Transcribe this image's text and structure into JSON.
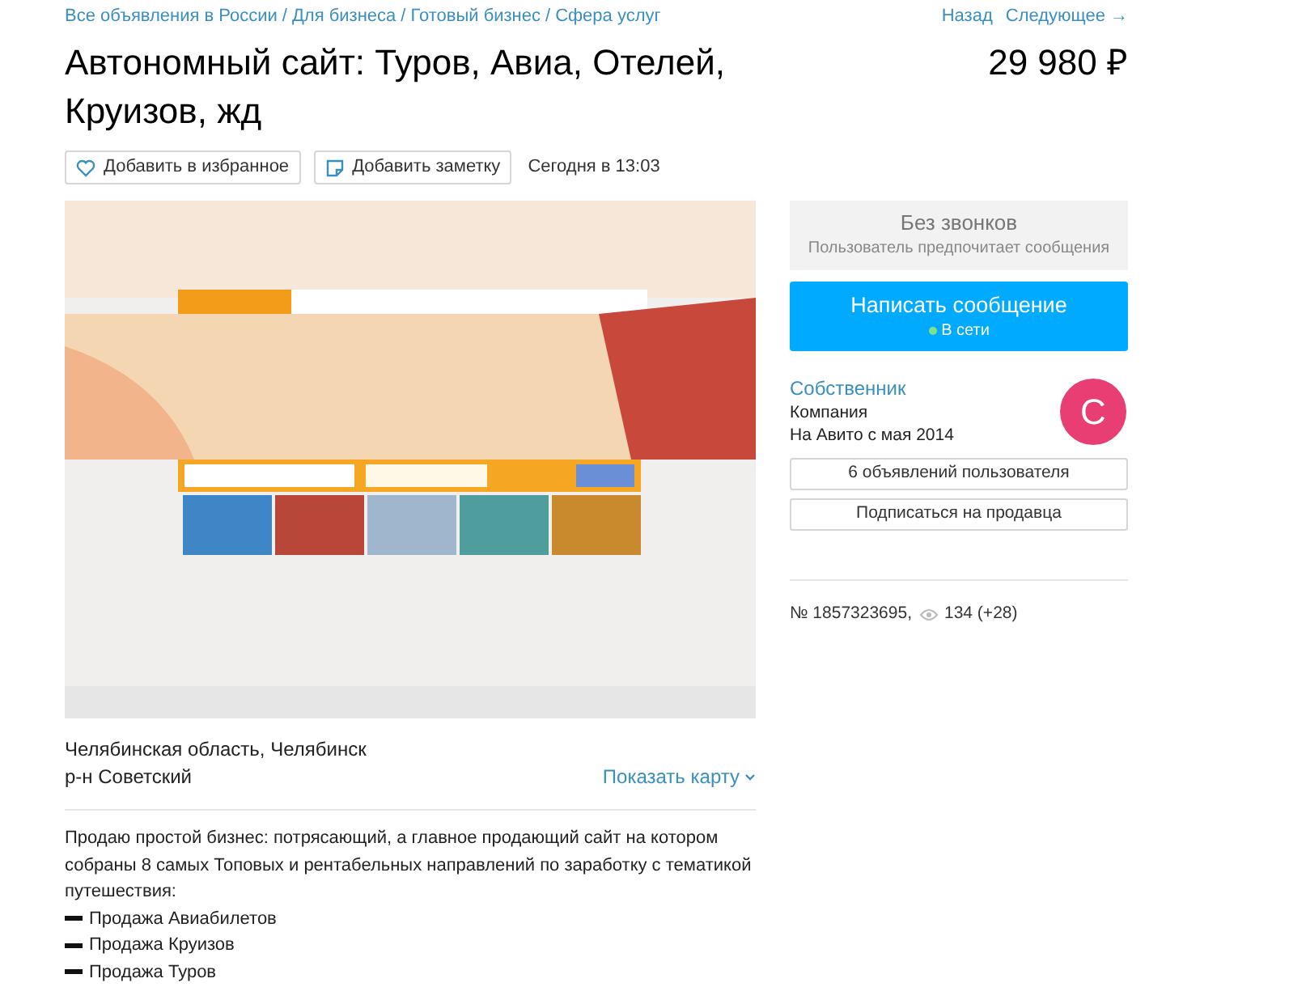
{
  "breadcrumbs": [
    "Все объявления в России",
    "Для бизнеса",
    "Готовый бизнес",
    "Сфера услуг"
  ],
  "breadcrumb_separator": "/",
  "nav": [
    "Назад",
    "Следующее →"
  ],
  "title": "Автономный сайт: Туров, Авиа, Отелей, Круизов, жд",
  "price": "29 980 ₽",
  "actions": [
    {
      "kind": "favorite",
      "label": "Добавить в избранное"
    },
    {
      "kind": "note",
      "label": "Добавить заметку"
    }
  ],
  "posted": "Сегодня в 13:03",
  "photo": {
    "kind": "picture"
  },
  "calls": {
    "title": "Без звонков",
    "subtitle": "Пользователь предпочитает сообщения"
  },
  "message_button": {
    "label": "Написать сообщение",
    "status": "В сети",
    "online": true
  },
  "seller": {
    "name": "Собственник",
    "type": "Компания",
    "since": "На Авито с мая 2014",
    "avatar_letter": "С",
    "color": "#e83e74"
  },
  "seller_buttons": [
    "6 объявлений пользователя",
    "Подписаться на продавца"
  ],
  "ad_number": "№ 1857323695,",
  "views": "134 (+28)",
  "location": [
    "Челябинская область, Челябинск",
    "р-н Советский"
  ],
  "map_link": "Показать карту",
  "description": "Продаю простой бизнес: потрясающий, а главное продающий сайт на котором собраны 8 самых Топовых и рентабельных направлений по заработку с тематикой путешествия:",
  "list_items": [
    "Продажа Авиабилетов",
    "Продажа Круизов",
    "Продажа Туров"
  ]
}
